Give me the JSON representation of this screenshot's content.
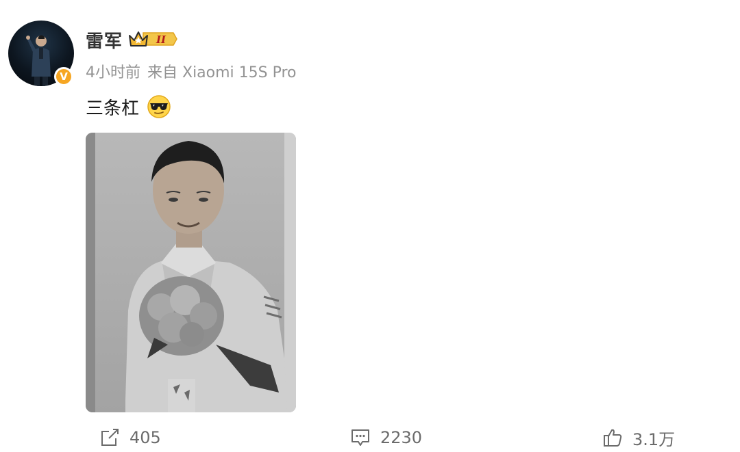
{
  "post": {
    "author": {
      "name": "雷军",
      "verified_badge": "V",
      "level_badge": "II"
    },
    "meta": {
      "time": "4小时前",
      "source": "来自 Xiaomi 15S Pro"
    },
    "content": {
      "text": "三条杠",
      "emoji": "cool-sunglasses-emoji"
    },
    "image": {
      "description_icon": "photo"
    },
    "actions": {
      "repost": {
        "icon": "share-icon",
        "count": "405"
      },
      "comment": {
        "icon": "comment-icon",
        "count": "2230"
      },
      "like": {
        "icon": "thumbs-up-icon",
        "count": "3.1万"
      }
    }
  },
  "colors": {
    "badge_orange": "#f6a623",
    "meta_gray": "#939393",
    "action_gray": "#6b6b6b"
  }
}
